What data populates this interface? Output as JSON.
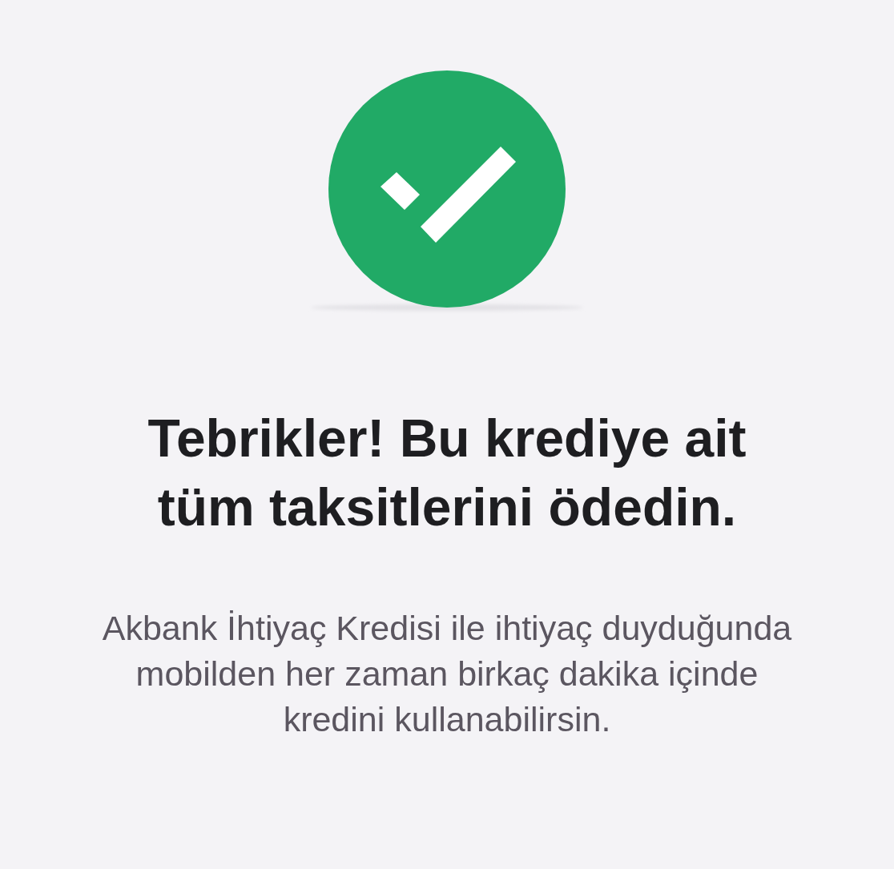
{
  "status_icon": {
    "kind": "success"
  },
  "title": "Tebrikler! Bu krediye ait\ntüm taksitlerini ödedin.",
  "message": "Akbank İhtiyaç Kredisi ile ihtiyaç duyduğunda\nmobilden her zaman birkaç dakika içinde\nkredini kullanabilirsin."
}
